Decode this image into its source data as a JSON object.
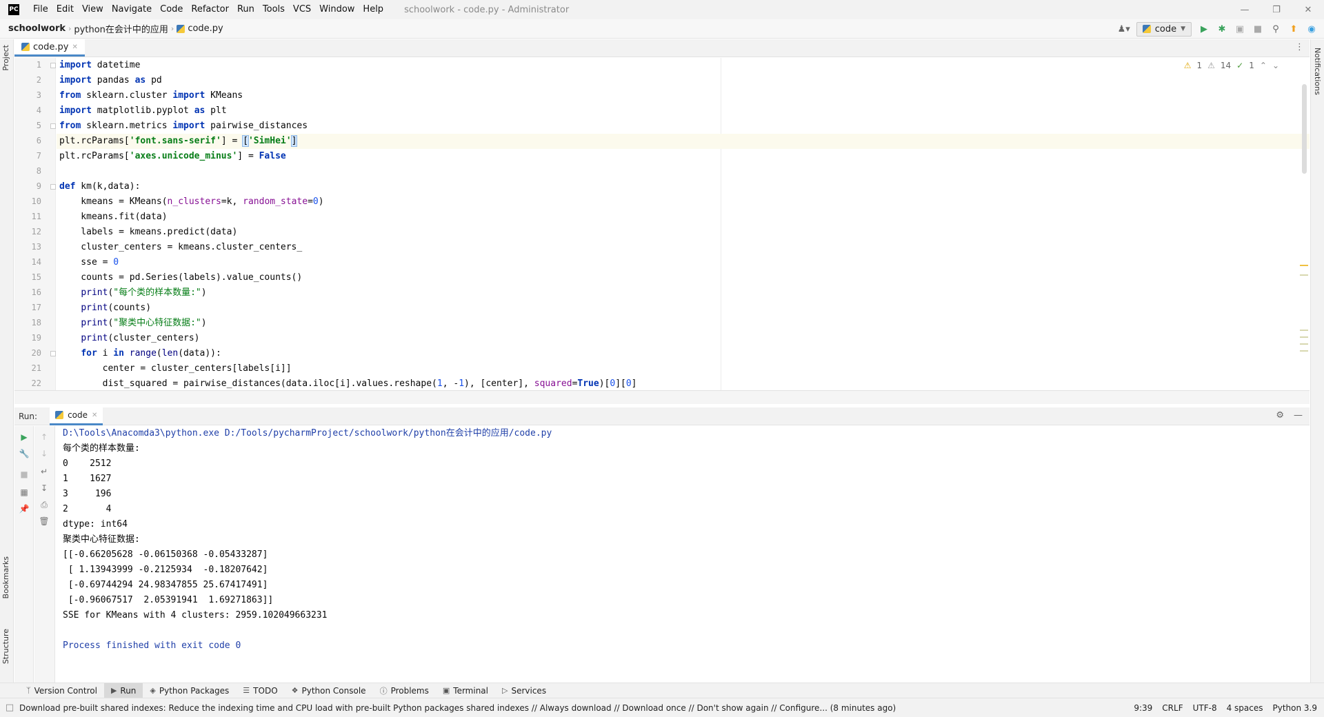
{
  "menubar": {
    "logo": "PC",
    "items": [
      "File",
      "Edit",
      "View",
      "Navigate",
      "Code",
      "Refactor",
      "Run",
      "Tools",
      "VCS",
      "Window",
      "Help"
    ],
    "title": "schoolwork - code.py - Administrator"
  },
  "navbar": {
    "project": "schoolwork",
    "folder": "python在会计中的应用",
    "file": "code.py",
    "run_config": "code"
  },
  "left_strip": {
    "project": "Project",
    "bookmarks": "Bookmarks",
    "structure": "Structure"
  },
  "right_strip": {
    "notifications": "Notifications"
  },
  "editor": {
    "tab_label": "code.py",
    "inspections": {
      "warnings": "1",
      "weak_warnings": "14",
      "typos": "1"
    },
    "line_numbers": [
      "1",
      "2",
      "3",
      "4",
      "5",
      "6",
      "7",
      "8",
      "9",
      "10",
      "11",
      "12",
      "13",
      "14",
      "15",
      "16",
      "17",
      "18",
      "19",
      "20",
      "21",
      "22"
    ]
  },
  "run": {
    "label": "Run:",
    "tab": "code",
    "console": [
      "D:\\Tools\\Anacomda3\\python.exe D:/Tools/pycharmProject/schoolwork/python在会计中的应用/code.py",
      "每个类的样本数量:",
      "0    2512",
      "1    1627",
      "3     196",
      "2       4",
      "dtype: int64",
      "聚类中心特征数据:",
      "[[-0.66205628 -0.06150368 -0.05433287]",
      " [ 1.13943999 -0.2125934  -0.18207642]",
      " [-0.69744294 24.98347855 25.67417491]",
      " [-0.96067517  2.05391941  1.69271863]]",
      "SSE for KMeans with 4 clusters: 2959.102049663231",
      "",
      "Process finished with exit code 0"
    ]
  },
  "toolwindows": [
    "Version Control",
    "Run",
    "Python Packages",
    "TODO",
    "Python Console",
    "Problems",
    "Terminal",
    "Services"
  ],
  "status": {
    "message": "Download pre-built shared indexes: Reduce the indexing time and CPU load with pre-built Python packages shared indexes // Always download // Download once // Don't show again // Configure... (8 minutes ago)",
    "position": "9:39",
    "line_sep": "CRLF",
    "encoding": "UTF-8",
    "indent": "4 spaces",
    "interpreter": "Python 3.9"
  }
}
